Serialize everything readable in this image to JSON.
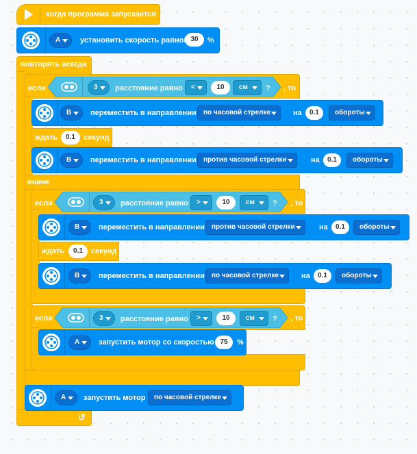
{
  "hat": {
    "label": "когда программа запускается"
  },
  "set_speed": {
    "port": "A",
    "label": "установить скорость равной",
    "value": "30",
    "unit": "%"
  },
  "forever": {
    "label": "повторять всегда"
  },
  "if1": {
    "if_label": "если",
    "then_label": ", то",
    "else_label": "иначе",
    "condition": {
      "port": "3",
      "label": "расстояние равно",
      "op": "<",
      "value": "10",
      "unit": "см",
      "q": "?"
    },
    "then_blocks": [
      {
        "port": "B",
        "label": "переместить в направлении",
        "direction": "по часовой стрелке",
        "on": "на",
        "amount": "0.1",
        "units": "обороты"
      },
      {
        "wait_label": "ждать",
        "value": "0.1",
        "unit": "секунд"
      },
      {
        "port": "B",
        "label": "переместить в направлении",
        "direction": "против часовой стрелки",
        "on": "на",
        "amount": "0.1",
        "units": "обороты"
      }
    ]
  },
  "if2": {
    "if_label": "если",
    "then_label": ", то",
    "condition": {
      "port": "3",
      "label": "расстояние равно",
      "op": ">",
      "value": "10",
      "unit": "см",
      "q": "?"
    },
    "then_blocks": [
      {
        "port": "B",
        "label": "переместить в направлении",
        "direction": "против часовой стрелки",
        "on": "на",
        "amount": "0.1",
        "units": "обороты"
      },
      {
        "wait_label": "ждать",
        "value": "0.1",
        "unit": "секунд"
      },
      {
        "port": "B",
        "label": "переместить в направлении",
        "direction": "по часовой стрелке",
        "on": "на",
        "amount": "0.1",
        "units": "обороты"
      }
    ]
  },
  "if3": {
    "if_label": "если",
    "then_label": ", то",
    "condition": {
      "port": "3",
      "label": "расстояние равно",
      "op": ">",
      "value": "10",
      "unit": "см",
      "q": "?"
    },
    "then_blocks": [
      {
        "port": "A",
        "label": "запустить мотор со скоростью",
        "value": "75",
        "unit": "%"
      }
    ]
  },
  "start_motor": {
    "port": "A",
    "label": "запустить мотор",
    "direction": "по часовой стрелке"
  },
  "icons": {
    "hat": "play-flag-icon",
    "motor": "motor-icon",
    "sensor": "distance-sensor-icon",
    "loop": "loop-arrow-icon"
  },
  "colors": {
    "control": "#ffbf00",
    "motor": "#0090f5",
    "sensor": "#4cbfe6"
  }
}
